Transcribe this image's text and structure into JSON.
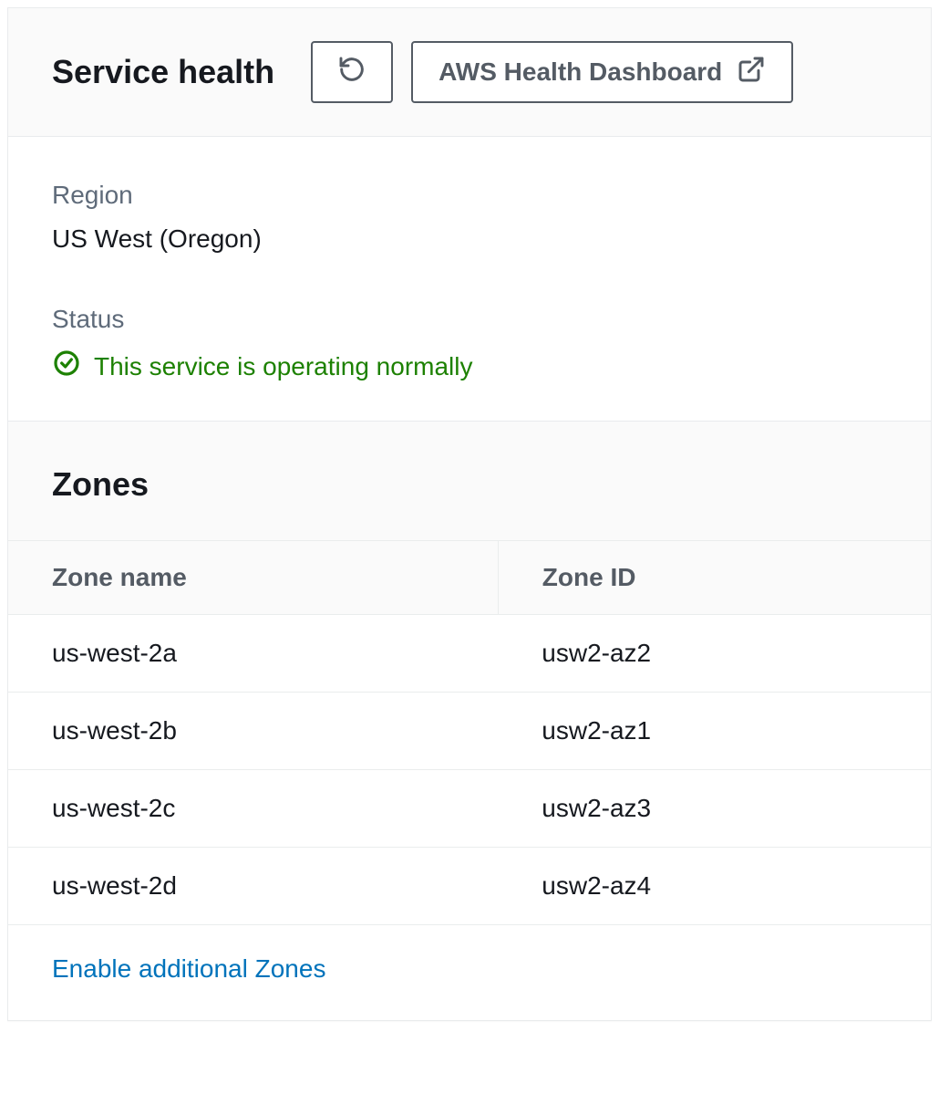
{
  "header": {
    "title": "Service health",
    "dashboard_button": "AWS Health Dashboard"
  },
  "service": {
    "region_label": "Region",
    "region_value": "US West (Oregon)",
    "status_label": "Status",
    "status_value": "This service is operating normally",
    "status_color": "#1d8102"
  },
  "zones": {
    "title": "Zones",
    "columns": {
      "name": "Zone name",
      "id": "Zone ID"
    },
    "rows": [
      {
        "name": "us-west-2a",
        "id": "usw2-az2"
      },
      {
        "name": "us-west-2b",
        "id": "usw2-az1"
      },
      {
        "name": "us-west-2c",
        "id": "usw2-az3"
      },
      {
        "name": "us-west-2d",
        "id": "usw2-az4"
      }
    ],
    "enable_link": "Enable additional Zones"
  }
}
